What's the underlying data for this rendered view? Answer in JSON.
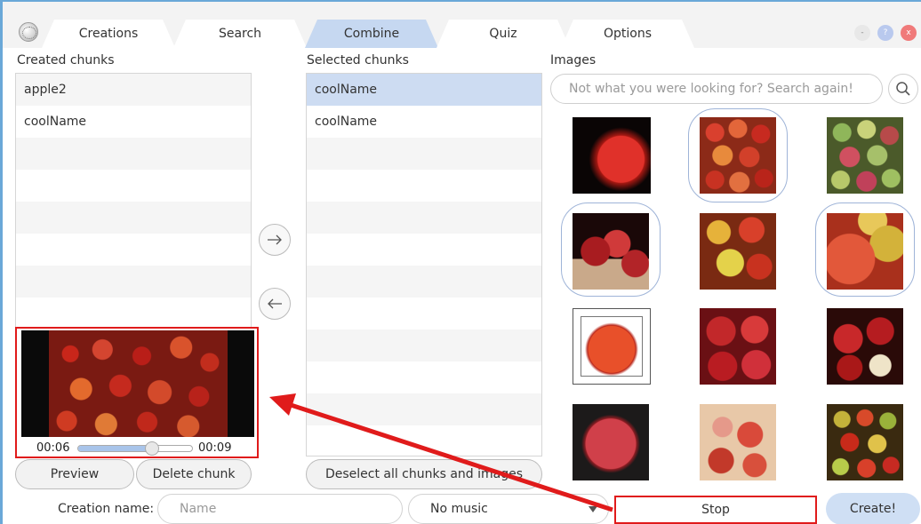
{
  "tabs": [
    "Creations",
    "Search",
    "Combine",
    "Quiz",
    "Options"
  ],
  "active_tab": "Combine",
  "window_buttons": [
    "-",
    "?",
    "x"
  ],
  "created": {
    "label": "Created chunks",
    "items": [
      "apple2",
      "coolName"
    ]
  },
  "selected": {
    "label": "Selected chunks",
    "items": [
      "coolName",
      "coolName"
    ]
  },
  "images": {
    "label": "Images",
    "search_placeholder": "Not what you were looking for? Search again!"
  },
  "video": {
    "current_time": "00:06",
    "total_time": "00:09",
    "progress": 0.65
  },
  "buttons": {
    "preview": "Preview",
    "delete_chunk": "Delete chunk",
    "deselect_all": "Deselect all chunks and images",
    "stop": "Stop",
    "create": "Create!"
  },
  "creation_name": {
    "label": "Creation name:",
    "placeholder": "Name"
  },
  "music": {
    "selected": "No music"
  },
  "colors": {
    "accent_blue": "#cddcf2",
    "annotation_red": "#e01b1b",
    "window_border": "#6aa8d8"
  }
}
